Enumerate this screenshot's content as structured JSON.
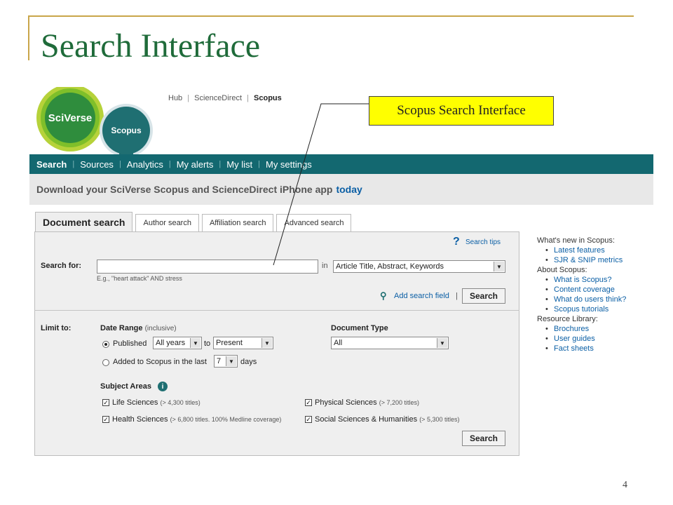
{
  "slide": {
    "title": "Search Interface",
    "page_number": "4",
    "callout": "Scopus Search Interface"
  },
  "logos": {
    "sciverse": "SciVerse",
    "scopus": "Scopus"
  },
  "top_links": {
    "hub": "Hub",
    "sciencedirect": "ScienceDirect",
    "scopus": "Scopus",
    "separator": "|"
  },
  "nav": {
    "items": [
      "Search",
      "Sources",
      "Analytics",
      "My alerts",
      "My list",
      "My settings"
    ],
    "separator": "|"
  },
  "promo": {
    "text": "Download your SciVerse Scopus and ScienceDirect iPhone app",
    "link": "today"
  },
  "tabs": [
    "Document search",
    "Author search",
    "Affiliation search",
    "Advanced search"
  ],
  "search": {
    "tips": "Search tips",
    "search_for_label": "Search for:",
    "query_value": "",
    "example": "E.g., \"heart attack\" AND stress",
    "in_label": "in",
    "field_select": "Article Title, Abstract, Keywords",
    "add_field": "Add search field",
    "separator": "|",
    "button": "Search"
  },
  "limits": {
    "limit_label": "Limit to:",
    "date_range_label": "Date Range",
    "date_range_note": "(inclusive)",
    "published_label": "Published",
    "from_select": "All years",
    "to_label": "to",
    "to_select": "Present",
    "added_label": "Added to Scopus in the last",
    "days_select": "7",
    "days_label": "days",
    "doc_type_label": "Document Type",
    "doc_type_select": "All",
    "subject_areas_label": "Subject Areas",
    "info_glyph": "i",
    "subjects": [
      {
        "name": "Life Sciences",
        "note": "(> 4,300 titles)"
      },
      {
        "name": "Health Sciences",
        "note": "(> 6,800 titles. 100% Medline coverage)"
      },
      {
        "name": "Physical Sciences",
        "note": "(> 7,200 titles)"
      },
      {
        "name": "Social Sciences & Humanities",
        "note": "(> 5,300 titles)"
      }
    ],
    "button": "Search"
  },
  "sidebar": {
    "whats_new": "What's new in Scopus:",
    "whats_new_items": [
      "Latest features",
      "SJR & SNIP metrics"
    ],
    "about": "About Scopus:",
    "about_items": [
      "What is Scopus?",
      "Content coverage",
      "What do users think?",
      "Scopus tutorials"
    ],
    "resources": "Resource Library:",
    "resource_items": [
      "Brochures",
      "User guides",
      "Fact sheets"
    ]
  },
  "colors": {
    "title_green": "#1f6b3a",
    "nav_teal": "#136870",
    "callout_yellow": "#ffff00",
    "link_blue": "#0b5fa5",
    "frame_gold": "#c9a64a"
  }
}
